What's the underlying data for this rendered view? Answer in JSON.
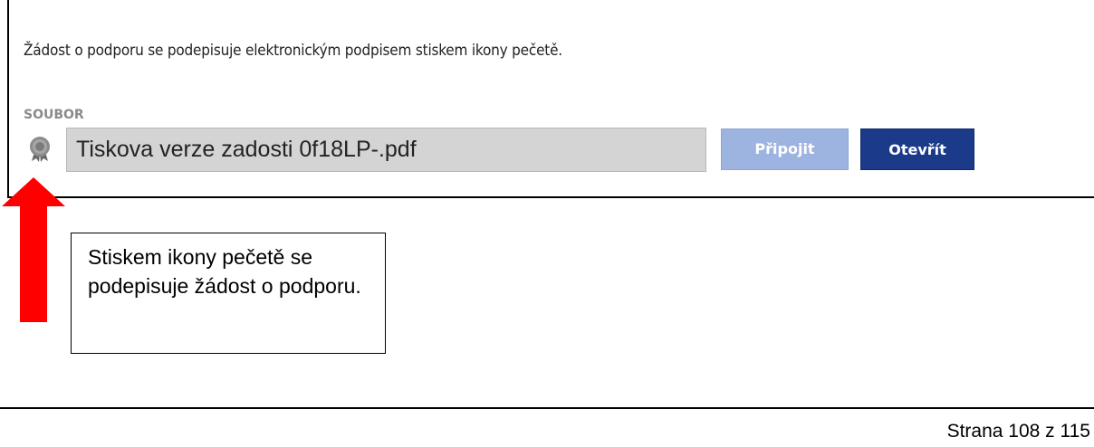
{
  "form": {
    "intro_text": "Žádost o podporu se podepisuje elektronickým podpisem stiskem ikony pečetě.",
    "field_label": "SOUBOR",
    "file_name": "Tiskova verze zadosti 0f18LP-.pdf",
    "attach_label": "Připojit",
    "open_label": "Otevřít",
    "seal_icon": "seal-icon",
    "colors": {
      "attach_button": "#9db3e0",
      "open_button": "#1b3a8a",
      "field_bg": "#d4d4d4"
    }
  },
  "annotation": {
    "callout_text": "Stiskem ikony pečetě se podepisuje žádost o podporu.",
    "arrow_color": "#ff0000"
  },
  "footer": {
    "page_text": "Strana 108 z 115"
  }
}
